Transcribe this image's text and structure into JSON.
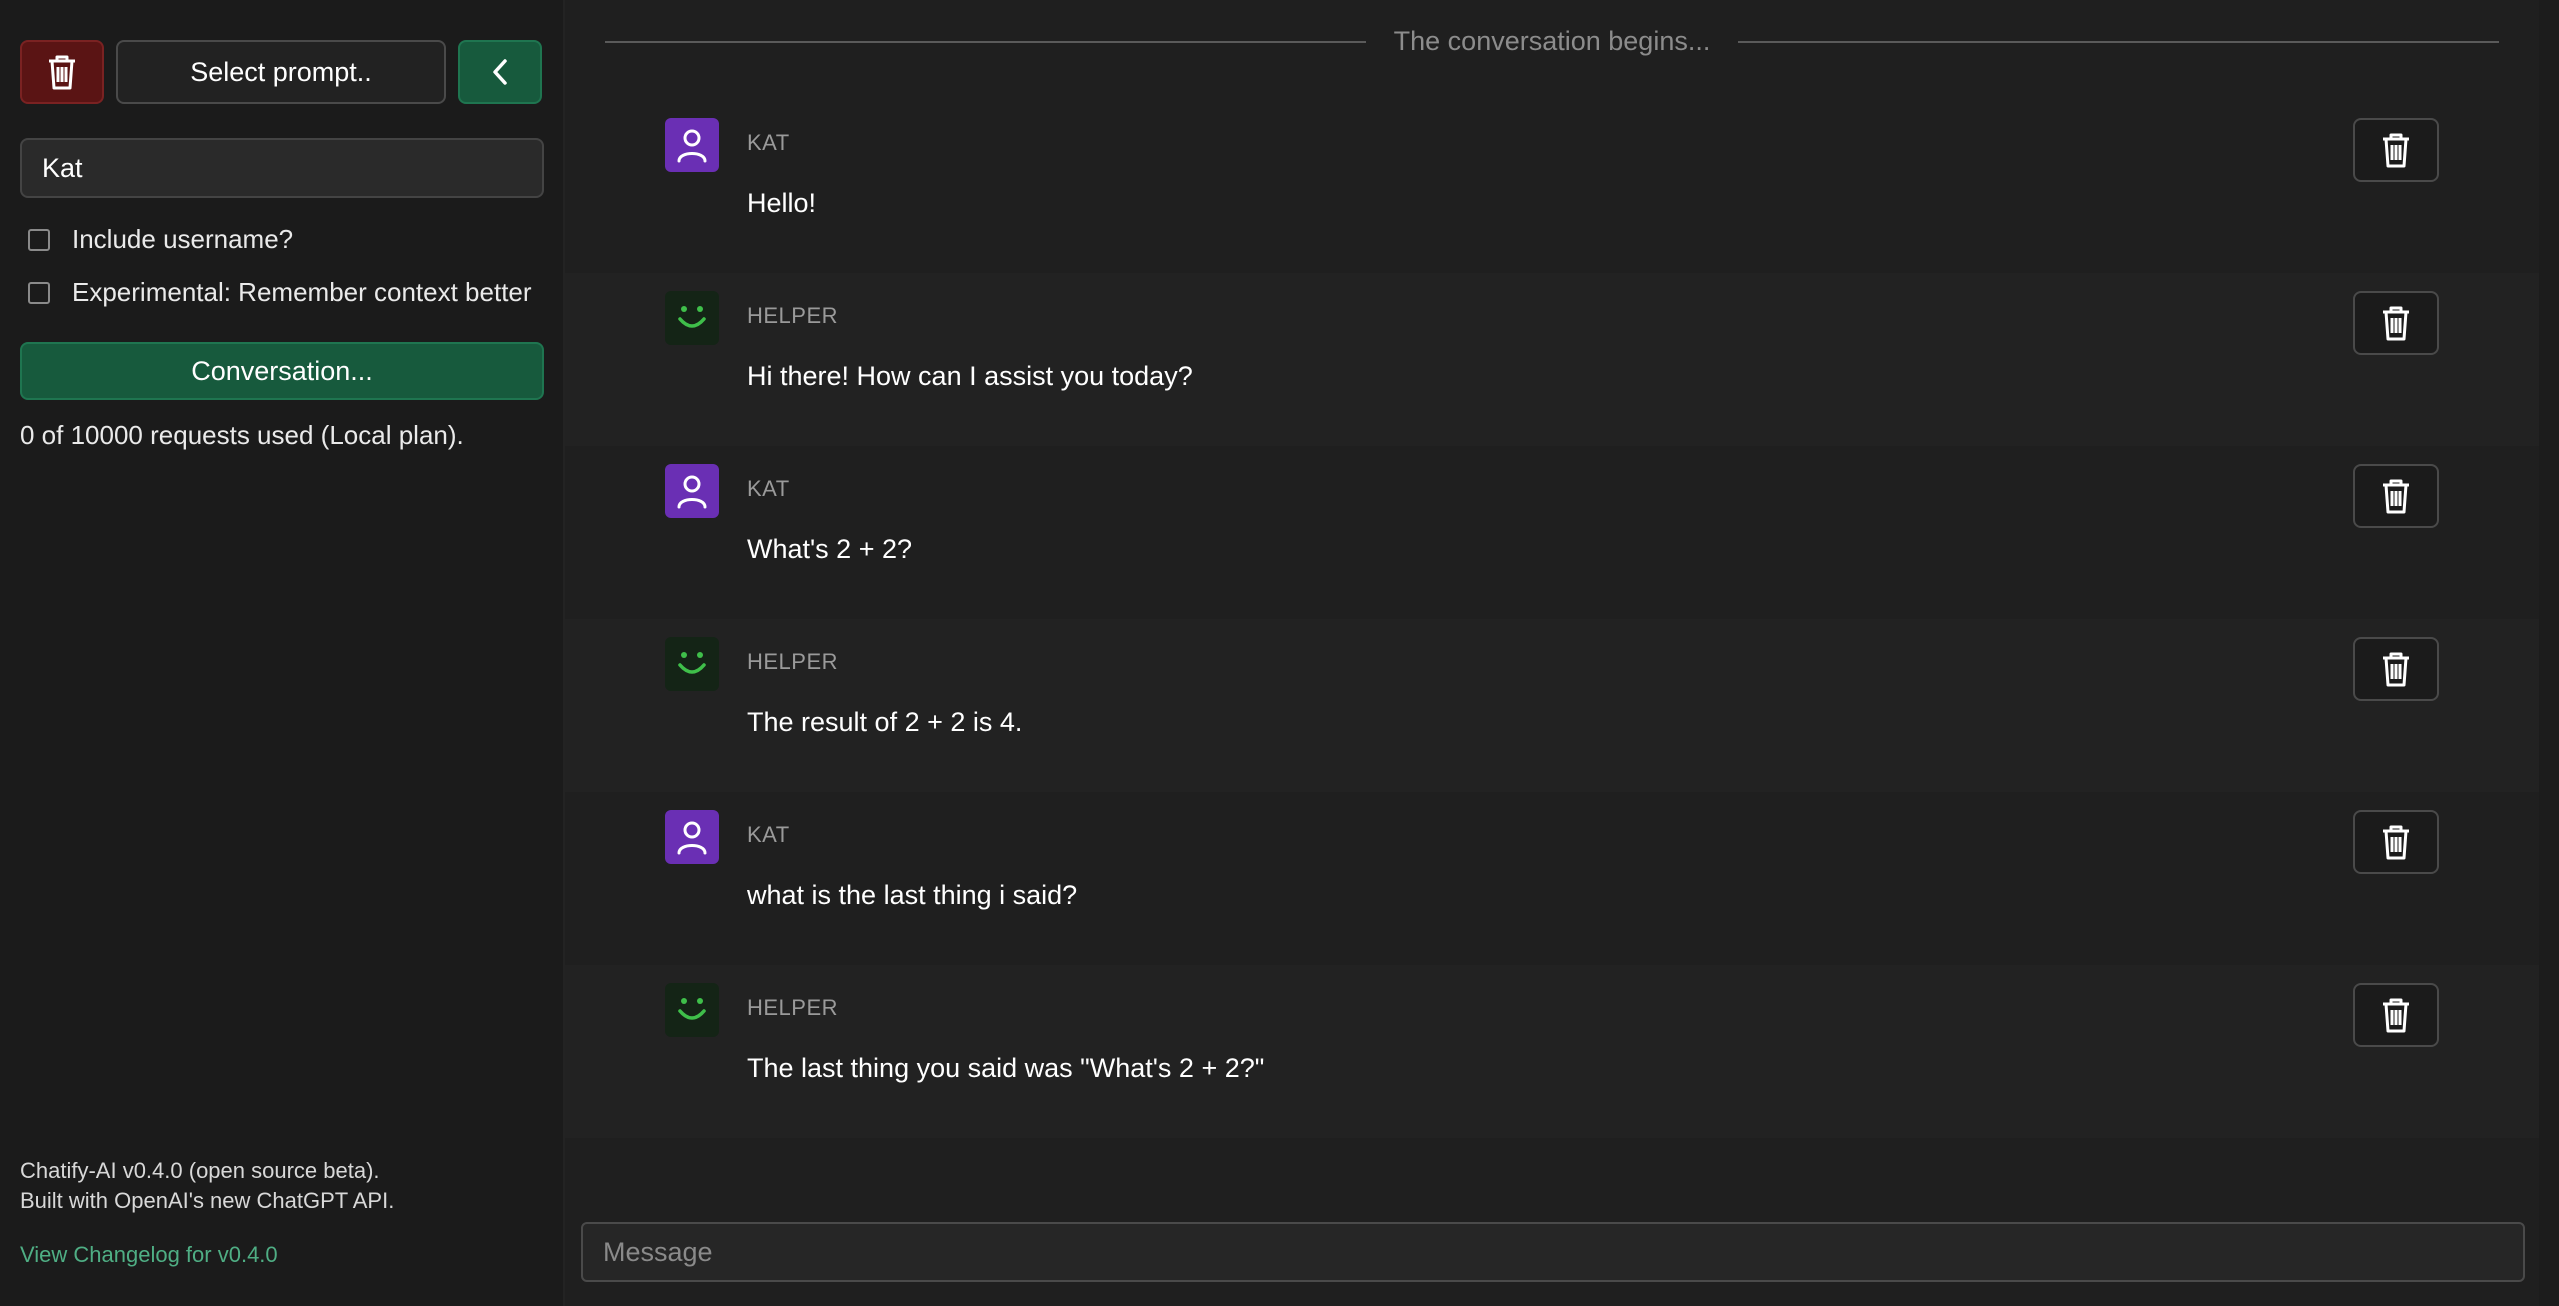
{
  "sidebar": {
    "select_prompt_label": "Select prompt..",
    "username_value": "Kat",
    "include_username_label": "Include username?",
    "experimental_label": "Experimental: Remember context better",
    "conversation_button_label": "Conversation...",
    "usage_text": "0 of 10000 requests used (Local plan).",
    "footer": {
      "version_line": "Chatify-AI v0.4.0 (open source beta).",
      "built_line": "Built with OpenAI's new ChatGPT API.",
      "changelog_link": "View Changelog for v0.4.0"
    }
  },
  "main": {
    "divider_text": "The conversation begins...",
    "messages": [
      {
        "role": "KAT",
        "text": "Hello!"
      },
      {
        "role": "HELPER",
        "text": "Hi there! How can I assist you today?"
      },
      {
        "role": "KAT",
        "text": "What's 2 + 2?"
      },
      {
        "role": "HELPER",
        "text": "The result of 2 + 2 is 4."
      },
      {
        "role": "KAT",
        "text": "what is the last thing i said?"
      },
      {
        "role": "HELPER",
        "text": "The last thing you said was \"What's 2 + 2?\""
      }
    ],
    "composer_placeholder": "Message"
  },
  "colors": {
    "accent_green": "#175a3d",
    "danger_red": "#5a1414",
    "user_avatar": "#6a2fb4",
    "bot_face": "#3fbf4a",
    "link": "#4fae84"
  },
  "icons": {
    "delete": "trash-icon",
    "back": "chevron-left-icon",
    "user": "person-icon",
    "bot": "smiley-icon"
  }
}
